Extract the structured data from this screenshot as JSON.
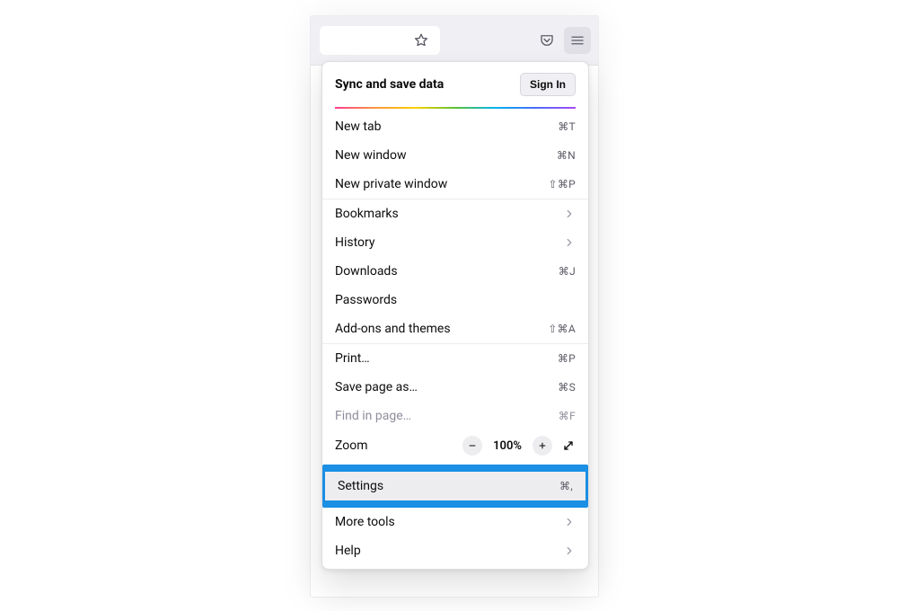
{
  "toolbar": {
    "icons": [
      "star-icon",
      "pocket-icon",
      "hamburger-icon"
    ]
  },
  "sync": {
    "title": "Sync and save data",
    "signin_label": "Sign In"
  },
  "items": {
    "new_tab": {
      "label": "New tab",
      "shortcut": "⌘T"
    },
    "new_window": {
      "label": "New window",
      "shortcut": "⌘N"
    },
    "new_private": {
      "label": "New private window",
      "shortcut": "⇧⌘P"
    },
    "bookmarks": {
      "label": "Bookmarks"
    },
    "history": {
      "label": "History"
    },
    "downloads": {
      "label": "Downloads",
      "shortcut": "⌘J"
    },
    "passwords": {
      "label": "Passwords"
    },
    "addons": {
      "label": "Add-ons and themes",
      "shortcut": "⇧⌘A"
    },
    "print": {
      "label": "Print…",
      "shortcut": "⌘P"
    },
    "save_page": {
      "label": "Save page as…",
      "shortcut": "⌘S"
    },
    "find": {
      "label": "Find in page…",
      "shortcut": "⌘F"
    },
    "zoom": {
      "label": "Zoom",
      "value": "100%"
    },
    "settings": {
      "label": "Settings",
      "shortcut": "⌘,"
    },
    "more_tools": {
      "label": "More tools"
    },
    "help": {
      "label": "Help"
    }
  }
}
